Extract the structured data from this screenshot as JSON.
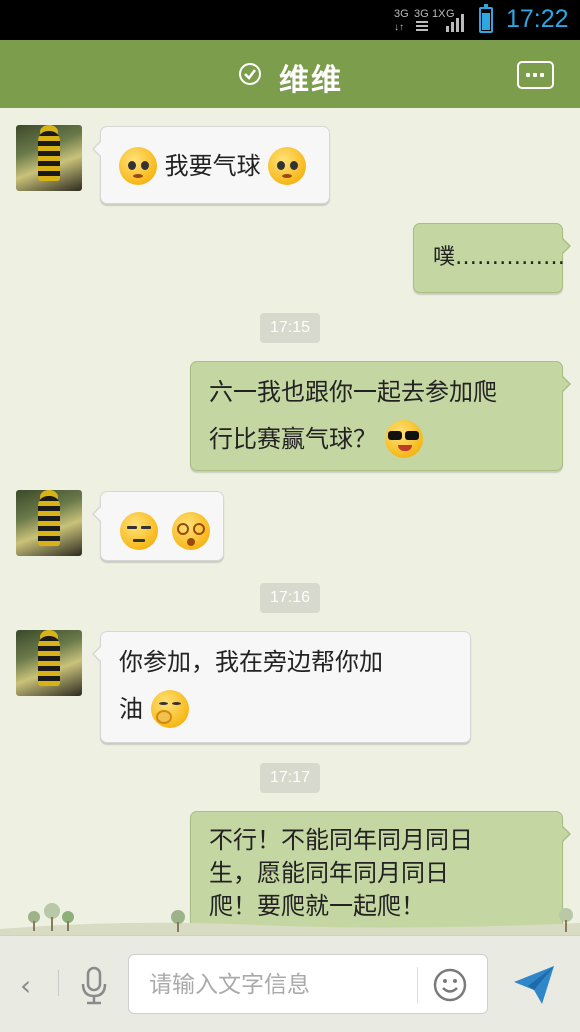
{
  "status_bar": {
    "network_1": "3G",
    "network_2": "3G",
    "network_3": "G",
    "time": "17:22",
    "accent_color": "#2fa6e0",
    "battery_level": 0.85
  },
  "header": {
    "title": "维维",
    "status_icon": "check-circle-icon",
    "menu_icon": "more-icon",
    "color": "#7c9d4c"
  },
  "messages": [
    {
      "side": "left",
      "text": "我要气球",
      "emoji_before": "pleading-face",
      "emoji_after": "pleading-face"
    },
    {
      "side": "right",
      "text": "噗……………"
    },
    {
      "type": "time",
      "text": "17:15"
    },
    {
      "side": "right",
      "line1": "六一我也跟你一起去参加爬",
      "line2": "行比赛赢气球？",
      "emoji_after": "sunglasses-face"
    },
    {
      "side": "left",
      "emoji_1": "annoyed-face",
      "emoji_2": "dizzy-face"
    },
    {
      "type": "time",
      "text": "17:16"
    },
    {
      "side": "left",
      "line1": "你参加，我在旁边帮你加",
      "line2": "油",
      "emoji_after": "yawning-face"
    },
    {
      "type": "time",
      "text": "17:17"
    },
    {
      "side": "right",
      "line1": "不行！不能同年同月同日",
      "line2": "生，愿能同年同月同日",
      "line3": "爬！要爬就一起爬！"
    }
  ],
  "input_bar": {
    "placeholder": "请输入文字信息",
    "back_icon": "chevron-left-icon",
    "voice_icon": "microphone-icon",
    "emoji_icon": "smiley-icon",
    "send_icon": "send-icon"
  }
}
